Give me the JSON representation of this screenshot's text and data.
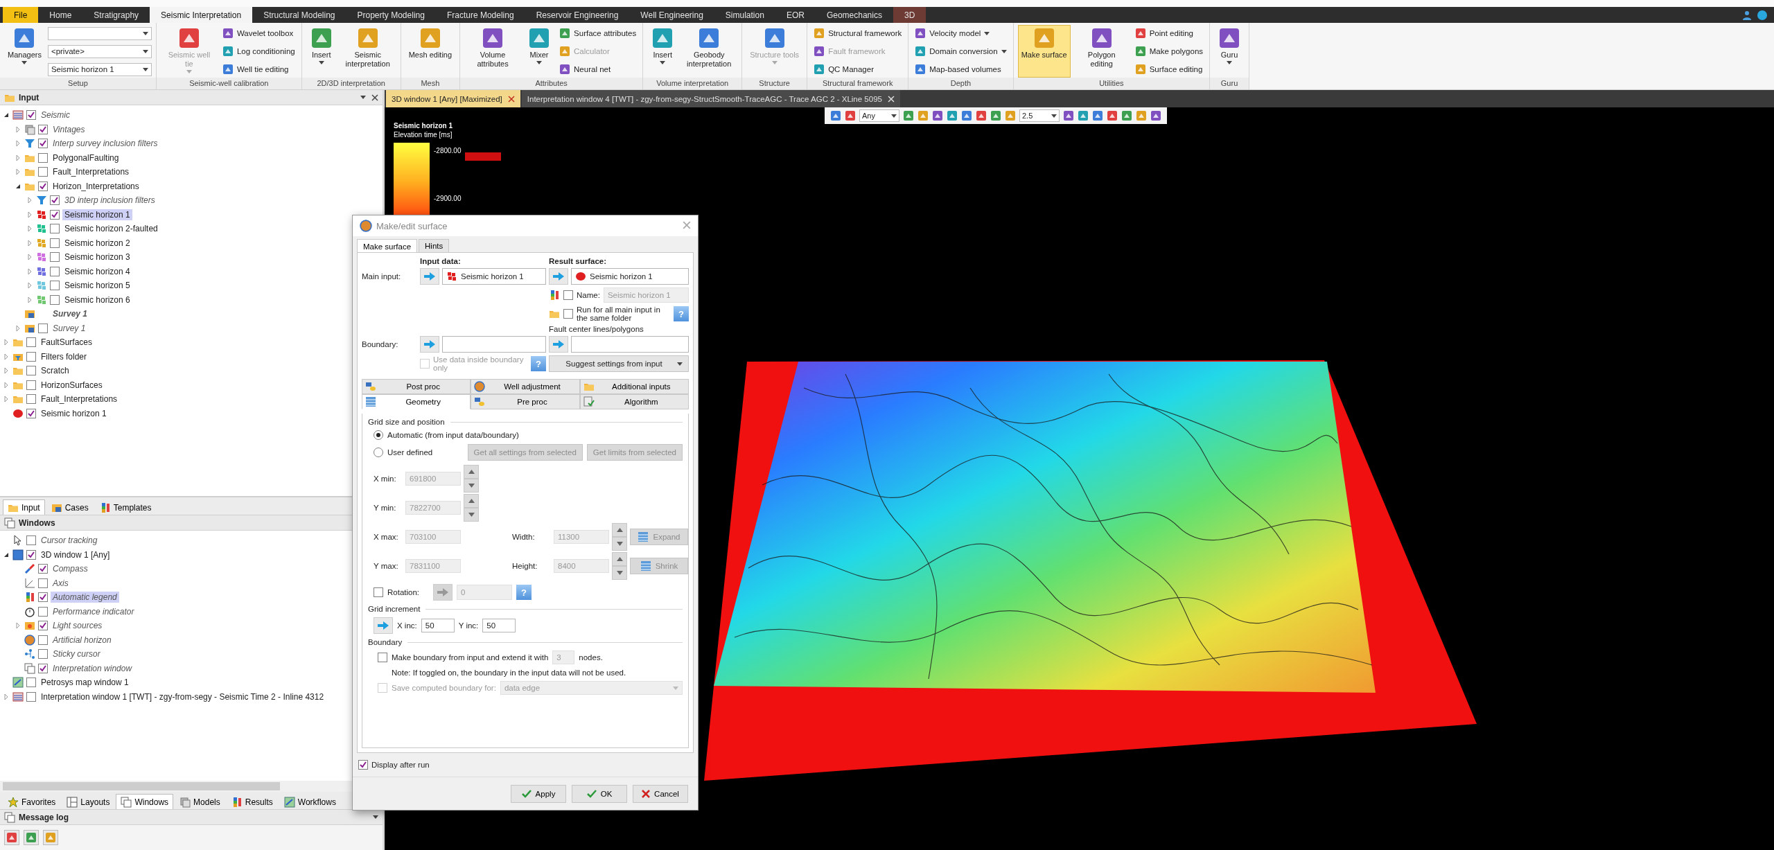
{
  "menu_tabs": [
    {
      "label": "File",
      "kind": "file",
      "selected": false
    },
    {
      "label": "Home",
      "kind": "tab",
      "selected": false
    },
    {
      "label": "Stratigraphy",
      "kind": "tab",
      "selected": false
    },
    {
      "label": "Seismic Interpretation",
      "kind": "tab",
      "selected": true
    },
    {
      "label": "Structural Modeling",
      "kind": "tab",
      "selected": false
    },
    {
      "label": "Property Modeling",
      "kind": "tab",
      "selected": false
    },
    {
      "label": "Fracture Modeling",
      "kind": "tab",
      "selected": false
    },
    {
      "label": "Reservoir Engineering",
      "kind": "tab",
      "selected": false
    },
    {
      "label": "Well Engineering",
      "kind": "tab",
      "selected": false
    },
    {
      "label": "Simulation",
      "kind": "tab",
      "selected": false
    },
    {
      "label": "EOR",
      "kind": "tab",
      "selected": false
    },
    {
      "label": "Geomechanics",
      "kind": "tab",
      "selected": false
    },
    {
      "label": "3D",
      "kind": "context",
      "selected": false
    }
  ],
  "ribbon": [
    {
      "title": "Setup",
      "items": [
        {
          "kind": "large",
          "label": "Managers",
          "menu": true,
          "disabled": false,
          "active": false
        },
        {
          "kind": "combo"
        },
        {
          "kind": "combo",
          "value": "<private>"
        },
        {
          "kind": "combo",
          "value": "Seismic horizon 1"
        }
      ]
    },
    {
      "title": "Seismic-well calibration",
      "items": [
        {
          "kind": "large",
          "label": "Seismic well tie",
          "menu": true,
          "disabled": true,
          "active": false
        },
        {
          "kind": "small",
          "label": "Wavelet toolbox",
          "disabled": false
        },
        {
          "kind": "small",
          "label": "Log conditioning",
          "disabled": false
        },
        {
          "kind": "small",
          "label": "Well tie editing",
          "disabled": false
        }
      ]
    },
    {
      "title": "2D/3D interpretation",
      "items": [
        {
          "kind": "large",
          "label": "Insert",
          "menu": true,
          "disabled": false,
          "active": false
        },
        {
          "kind": "large",
          "label": "Seismic interpretation",
          "disabled": false,
          "active": false
        }
      ]
    },
    {
      "title": "Mesh",
      "items": [
        {
          "kind": "large",
          "label": "Mesh editing",
          "disabled": false,
          "active": false
        }
      ]
    },
    {
      "title": "Attributes",
      "items": [
        {
          "kind": "large",
          "label": "Volume attributes",
          "disabled": false,
          "active": false
        },
        {
          "kind": "large",
          "label": "Mixer",
          "menu": true,
          "disabled": false,
          "active": false
        },
        {
          "kind": "small",
          "label": "Surface attributes",
          "disabled": false
        },
        {
          "kind": "small",
          "label": "Calculator",
          "disabled": true
        },
        {
          "kind": "small",
          "label": "Neural net",
          "disabled": false
        }
      ]
    },
    {
      "title": "Volume interpretation",
      "items": [
        {
          "kind": "large",
          "label": "Insert",
          "menu": true,
          "disabled": false,
          "active": false
        },
        {
          "kind": "large",
          "label": "Geobody interpretation",
          "disabled": false,
          "active": false
        }
      ]
    },
    {
      "title": "Structure",
      "items": [
        {
          "kind": "large",
          "label": "Structure tools",
          "menu": true,
          "disabled": true,
          "active": false
        }
      ]
    },
    {
      "title": "Structural framework",
      "items": [
        {
          "kind": "small",
          "label": "Structural framework",
          "disabled": false
        },
        {
          "kind": "small",
          "label": "Fault framework",
          "disabled": true
        },
        {
          "kind": "small",
          "label": "QC Manager",
          "disabled": false
        }
      ]
    },
    {
      "title": "Depth",
      "items": [
        {
          "kind": "small",
          "label": "Velocity model",
          "menu": true,
          "disabled": false
        },
        {
          "kind": "small",
          "label": "Domain conversion",
          "menu": true,
          "disabled": false
        },
        {
          "kind": "small",
          "label": "Map-based volumes",
          "disabled": false
        }
      ]
    },
    {
      "title": "Utilities",
      "items": [
        {
          "kind": "large",
          "label": "Make surface",
          "disabled": false,
          "active": true
        },
        {
          "kind": "large",
          "label": "Polygon editing",
          "disabled": false,
          "active": false
        },
        {
          "kind": "small",
          "label": "Point editing",
          "disabled": false
        },
        {
          "kind": "small",
          "label": "Make polygons",
          "disabled": false
        },
        {
          "kind": "small",
          "label": "Surface editing",
          "disabled": false
        }
      ]
    },
    {
      "title": "Guru",
      "items": [
        {
          "kind": "large",
          "label": "Guru",
          "menu": true,
          "disabled": false,
          "active": false
        }
      ]
    }
  ],
  "input_panel": {
    "title": "Input",
    "tree": [
      {
        "label": "Seismic",
        "kind": "seismic",
        "checked": true,
        "expanded": true,
        "virtual": true,
        "selected": false,
        "children": [
          {
            "label": "Vintages",
            "kind": "stack",
            "checked": true,
            "expanded": false,
            "virtual": true,
            "selected": false
          },
          {
            "label": "Interp survey inclusion filters",
            "kind": "filter",
            "checked": true,
            "expanded": false,
            "virtual": true,
            "selected": false
          },
          {
            "label": "PolygonalFaulting",
            "kind": "folder",
            "checked": false,
            "expanded": false,
            "virtual": false,
            "selected": false
          },
          {
            "label": "Fault_Interpretations",
            "kind": "folder",
            "checked": false,
            "expanded": false,
            "virtual": false,
            "selected": false
          },
          {
            "label": "Horizon_Interpretations",
            "kind": "folder",
            "checked": true,
            "expanded": true,
            "virtual": false,
            "selected": false,
            "children": [
              {
                "label": "3D interp inclusion filters",
                "kind": "filter",
                "checked": true,
                "expanded": false,
                "virtual": true,
                "selected": false
              },
              {
                "label": "Seismic horizon 1",
                "kind": "horizon",
                "color": "#e02020",
                "checked": true,
                "expanded": false,
                "virtual": false,
                "selected": true
              },
              {
                "label": "Seismic horizon 2-faulted",
                "kind": "horizon",
                "color": "#20c090",
                "checked": false,
                "expanded": false,
                "virtual": false,
                "selected": false
              },
              {
                "label": "Seismic horizon 2",
                "kind": "horizon",
                "color": "#e0a820",
                "checked": false,
                "expanded": false,
                "virtual": false,
                "selected": false
              },
              {
                "label": "Seismic horizon 3",
                "kind": "horizon",
                "color": "#d070e0",
                "checked": false,
                "expanded": false,
                "virtual": false,
                "selected": false
              },
              {
                "label": "Seismic horizon 4",
                "kind": "horizon",
                "color": "#7070e0",
                "checked": false,
                "expanded": false,
                "virtual": false,
                "selected": false
              },
              {
                "label": "Seismic horizon 5",
                "kind": "horizon",
                "color": "#70c8e0",
                "checked": false,
                "expanded": false,
                "virtual": false,
                "selected": false
              },
              {
                "label": "Seismic horizon 6",
                "kind": "horizon",
                "color": "#70c870",
                "checked": false,
                "expanded": false,
                "virtual": false,
                "selected": false
              }
            ]
          },
          {
            "label": "Survey 1",
            "kind": "survey",
            "virtual": true,
            "active": true,
            "selected": false
          },
          {
            "label": "Survey 1",
            "kind": "survey",
            "checked": false,
            "expanded": false,
            "virtual": true,
            "selected": false
          }
        ]
      },
      {
        "label": "FaultSurfaces",
        "kind": "folder",
        "checked": false,
        "expanded": false,
        "virtual": false,
        "selected": false
      },
      {
        "label": "Filters folder",
        "kind": "filter-folder",
        "checked": false,
        "expanded": false,
        "virtual": false,
        "selected": false
      },
      {
        "label": "Scratch",
        "kind": "folder",
        "checked": false,
        "expanded": false,
        "virtual": false,
        "selected": false
      },
      {
        "label": "HorizonSurfaces",
        "kind": "folder",
        "checked": false,
        "expanded": false,
        "virtual": false,
        "selected": false
      },
      {
        "label": "Fault_Interpretations",
        "kind": "folder",
        "checked": false,
        "expanded": false,
        "virtual": false,
        "selected": false
      },
      {
        "label": "Seismic horizon 1",
        "kind": "surface",
        "color": "#e02020",
        "checked": true,
        "virtual": false,
        "selected": false
      }
    ]
  },
  "panel_tabs": [
    {
      "label": "Input",
      "kind": "folder",
      "selected": true
    },
    {
      "label": "Cases",
      "kind": "survey",
      "selected": false
    },
    {
      "label": "Templates",
      "kind": "legend",
      "selected": false
    }
  ],
  "windows_panel": {
    "title": "Windows",
    "tree": [
      {
        "label": "Cursor tracking",
        "kind": "pointer",
        "checked": false,
        "virtual": true,
        "selected": false
      },
      {
        "label": "3D window 1 [Any]",
        "kind": "window3d",
        "checked": true,
        "expanded": true,
        "virtual": false,
        "selected": false,
        "children": [
          {
            "label": "Compass",
            "kind": "compass",
            "checked": true,
            "virtual": true,
            "selected": false
          },
          {
            "label": "Axis",
            "kind": "axis",
            "checked": false,
            "virtual": true,
            "selected": false
          },
          {
            "label": "Automatic legend",
            "kind": "legend",
            "checked": true,
            "virtual": true,
            "selected": true
          },
          {
            "label": "Performance indicator",
            "kind": "gauge",
            "checked": false,
            "virtual": true,
            "selected": false
          },
          {
            "label": "Light sources",
            "kind": "light",
            "checked": true,
            "expanded": false,
            "virtual": true,
            "selected": false
          },
          {
            "label": "Artificial horizon",
            "kind": "globe",
            "checked": false,
            "virtual": true,
            "selected": false
          },
          {
            "label": "Sticky cursor",
            "kind": "nodes",
            "checked": false,
            "virtual": true,
            "selected": false
          },
          {
            "label": "Interpretation window",
            "kind": "windows",
            "checked": true,
            "virtual": true,
            "selected": false
          }
        ]
      },
      {
        "label": "Petrosys map window 1",
        "kind": "map",
        "checked": false,
        "virtual": false,
        "selected": false
      },
      {
        "label": "Interpretation window 1 [TWT] - zgy-from-segy - Seismic Time 2 - Inline 4312",
        "kind": "seismic",
        "checked": false,
        "expanded": false,
        "virtual": false,
        "selected": false
      }
    ]
  },
  "bottom_tabs": [
    {
      "label": "Favorites",
      "kind": "star",
      "selected": false
    },
    {
      "label": "Layouts",
      "kind": "layout",
      "selected": false
    },
    {
      "label": "Windows",
      "kind": "windows",
      "selected": true
    },
    {
      "label": "Models",
      "kind": "stack",
      "selected": false
    },
    {
      "label": "Results",
      "kind": "legend",
      "selected": false
    },
    {
      "label": "Workflows",
      "kind": "map",
      "selected": false
    }
  ],
  "message_log": {
    "title": "Message log"
  },
  "doc_tabs": [
    {
      "label": "3D window 1 [Any] [Maximized]",
      "selected": true
    },
    {
      "label": "Interpretation window 4 [TWT] - zgy-from-segy-StructSmooth-TraceAGC - Trace AGC 2 - XLine 5095",
      "selected": false
    }
  ],
  "view_toolbar": {
    "mode": "Any",
    "zoom": "2.5"
  },
  "legend": {
    "title": "Seismic horizon 1",
    "subtitle": "Elevation time [ms]",
    "ticks": [
      "-2800.00",
      "-2900.00"
    ]
  },
  "dialog": {
    "title": "Make/edit surface",
    "tabs": [
      {
        "label": "Make surface",
        "selected": true
      },
      {
        "label": "Hints",
        "selected": false
      }
    ],
    "input_heading": "Input data:",
    "result_heading": "Result surface:",
    "main_input": {
      "label": "Main input:",
      "value": "Seismic horizon 1"
    },
    "result_surface": {
      "value": "Seismic horizon 1"
    },
    "name": {
      "label": "Name:",
      "checked": false,
      "value": "Seismic horizon 1",
      "disabled": true
    },
    "run_all": {
      "label": "Run for all main input in the same folder",
      "checked": false,
      "help": "?"
    },
    "fault_heading": "Fault center lines/polygons",
    "boundary": {
      "label": "Boundary:"
    },
    "use_inside": {
      "label": "Use data inside boundary only",
      "checked": false,
      "disabled": true,
      "help": "?"
    },
    "suggest_button": "Suggest settings from input",
    "sub_tab_rows": [
      [
        {
          "label": "Post proc",
          "kind": "tools",
          "selected": false
        },
        {
          "label": "Well adjustment",
          "kind": "globe",
          "selected": false
        },
        {
          "label": "Additional inputs",
          "kind": "folder",
          "selected": false
        }
      ],
      [
        {
          "label": "Geometry",
          "kind": "grid",
          "selected": true
        },
        {
          "label": "Pre proc",
          "kind": "tools",
          "selected": false
        },
        {
          "label": "Algorithm",
          "kind": "check",
          "selected": false
        }
      ]
    ],
    "geometry": {
      "section": "Grid size and position",
      "modes": [
        {
          "label": "Automatic (from input data/boundary)",
          "selected": true
        },
        {
          "label": "User defined",
          "selected": false
        }
      ],
      "buttons": [
        {
          "label": "Get all settings from selected",
          "disabled": true
        },
        {
          "label": "Get limits from selected",
          "disabled": true
        }
      ],
      "limits": [
        {
          "label": "X min:",
          "value": "691800",
          "disabled": true
        },
        {
          "label": "Y min:",
          "value": "7822700",
          "disabled": true
        },
        {
          "label": "X max:",
          "value": "703100",
          "disabled": true
        },
        {
          "label": "Y max:",
          "value": "7831100",
          "disabled": true
        }
      ],
      "size": [
        {
          "label": "Width:",
          "value": "11300",
          "disabled": true
        },
        {
          "label": "Height:",
          "value": "8400",
          "disabled": true
        }
      ],
      "resize_buttons": [
        {
          "label": "Expand",
          "disabled": true
        },
        {
          "label": "Shrink",
          "disabled": true
        }
      ],
      "rotation": {
        "label": "Rotation:",
        "checked": false,
        "value": "0",
        "help": "?"
      },
      "increment_section": "Grid increment",
      "increments": [
        {
          "label": "X inc:",
          "value": "50"
        },
        {
          "label": "Y inc:",
          "value": "50"
        }
      ],
      "boundary_section": "Boundary",
      "extend": {
        "label": "Make boundary from input and extend it with",
        "checked": false,
        "value": "3",
        "unit": "nodes."
      },
      "note": "Note: If toggled on, the boundary in the input data will not be used.",
      "save_boundary": {
        "label": "Save computed boundary for:",
        "checked": false,
        "disabled": true,
        "value": "data edge"
      }
    },
    "display_after_run": {
      "label": "Display after run",
      "checked": true
    },
    "buttons": [
      {
        "label": "Apply",
        "kind": "apply"
      },
      {
        "label": "OK",
        "kind": "ok"
      },
      {
        "label": "Cancel",
        "kind": "cancel"
      }
    ]
  }
}
